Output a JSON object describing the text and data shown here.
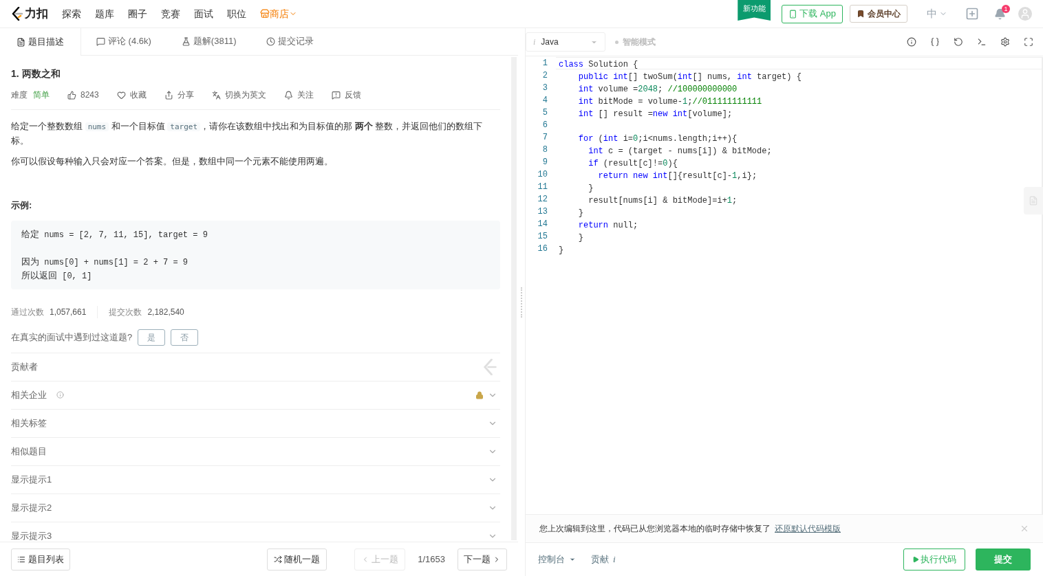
{
  "nav": {
    "brand": "力扣",
    "items": [
      {
        "label": "探索",
        "kind": "plain"
      },
      {
        "label": "题库",
        "kind": "plain"
      },
      {
        "label": "圈子",
        "kind": "plain"
      },
      {
        "label": "竞赛",
        "kind": "plain"
      },
      {
        "label": "面试",
        "kind": "plain"
      },
      {
        "label": "职位",
        "kind": "plain"
      },
      {
        "label": "商店",
        "kind": "store"
      }
    ],
    "new_feature": "新功能",
    "download": "下载 App",
    "vip": "会员中心",
    "language": "中",
    "notification_count": "1"
  },
  "tabs": [
    {
      "label": "题目描述",
      "selected": true
    },
    {
      "label": "评论 (4.6k)",
      "selected": false
    },
    {
      "label": "题解(3811)",
      "selected": false
    },
    {
      "label": "提交记录",
      "selected": false
    }
  ],
  "problem": {
    "title": "1. 两数之和",
    "difficulty_label": "难度",
    "difficulty": "简单",
    "actions": [
      "8243",
      "收藏",
      "分享",
      "切换为英文",
      "关注",
      "反馈"
    ],
    "paragraphs": [
      [
        {
          "kind": "text",
          "text": "给定一个整数数组 "
        },
        {
          "kind": "code",
          "text": "nums"
        },
        {
          "kind": "text",
          "text": " 和一个目标值 "
        },
        {
          "kind": "code",
          "text": "target"
        },
        {
          "kind": "text",
          "text": "，请你在该数组中找出和为目标值的那 **两个** 整数，并返回他们的数组下标。"
        }
      ],
      [
        {
          "kind": "text",
          "text": "你可以假设每种输入只会对应一个答案。但是，数组中同一个元素不能使用两遍。"
        }
      ]
    ],
    "example_heading": "示例:",
    "example_groups": [
      [
        [
          {
            "kind": "cjk",
            "text": "给定"
          },
          {
            "kind": "code",
            "text": " nums = [2, 7, 11, 15], target = 9"
          }
        ]
      ],
      [
        [
          {
            "kind": "cjk",
            "text": "因为"
          },
          {
            "kind": "code",
            "text": " nums[0] + nums[1] = 2 + 7 = 9"
          }
        ],
        [
          {
            "kind": "cjk",
            "text": "所以返回"
          },
          {
            "kind": "code",
            "text": " [0, 1]"
          }
        ]
      ]
    ],
    "stats": [
      {
        "label": "通过次数",
        "value": "1,057,661"
      },
      {
        "label": "提交次数",
        "value": "2,182,540"
      }
    ],
    "interview_question": "在真实的面试中遇到过这道题?",
    "interview_answers": [
      "是",
      "否"
    ],
    "sections": [
      {
        "label": "贡献者",
        "kind": "contributors",
        "expanded": false
      },
      {
        "label": "相关企业",
        "kind": "locked",
        "expanded": false
      },
      {
        "label": "相关标签",
        "kind": "plain",
        "expanded": false
      },
      {
        "label": "相似题目",
        "kind": "plain",
        "expanded": false
      },
      {
        "label": "显示提示1",
        "kind": "plain",
        "expanded": false
      },
      {
        "label": "显示提示2",
        "kind": "plain",
        "expanded": false
      },
      {
        "label": "显示提示3",
        "kind": "plain",
        "expanded": false
      }
    ]
  },
  "footer_left": {
    "list": "题目列表",
    "random": "随机一题",
    "prev": {
      "label": "上一题",
      "disabled": true
    },
    "page": "1/1653",
    "next": {
      "label": "下一题",
      "disabled": false
    }
  },
  "editor": {
    "language_hint": "i",
    "language": "Java",
    "smart_mode": {
      "label": "智能模式",
      "on": false
    },
    "lines": [
      {
        "number": "1",
        "tokens": [
          {
            "kind": "keyword",
            "text": "class"
          },
          {
            "kind": "plain",
            "text": " Solution {"
          }
        ]
      },
      {
        "number": "2",
        "tokens": [
          {
            "kind": "keyword",
            "text": "    public"
          },
          {
            "kind": "keyword",
            "text": " int"
          },
          {
            "kind": "plain",
            "text": "[] twoSum("
          },
          {
            "kind": "keyword",
            "text": "int"
          },
          {
            "kind": "plain",
            "text": "[] nums, "
          },
          {
            "kind": "keyword",
            "text": "int"
          },
          {
            "kind": "plain",
            "text": " target) {"
          }
        ]
      },
      {
        "number": "3",
        "tokens": [
          {
            "kind": "keyword",
            "text": "    int"
          },
          {
            "kind": "plain",
            "text": " volume ="
          },
          {
            "kind": "number",
            "text": "2048"
          },
          {
            "kind": "plain",
            "text": "; "
          },
          {
            "kind": "comment",
            "text": "//100000000000"
          }
        ]
      },
      {
        "number": "4",
        "tokens": [
          {
            "kind": "keyword",
            "text": "    int"
          },
          {
            "kind": "plain",
            "text": " bitMode = volume-"
          },
          {
            "kind": "number",
            "text": "1"
          },
          {
            "kind": "plain",
            "text": ";"
          },
          {
            "kind": "comment",
            "text": "//011111111111"
          }
        ]
      },
      {
        "number": "5",
        "tokens": [
          {
            "kind": "keyword",
            "text": "    int"
          },
          {
            "kind": "plain",
            "text": " [] result ="
          },
          {
            "kind": "keyword",
            "text": "new"
          },
          {
            "kind": "keyword",
            "text": " int"
          },
          {
            "kind": "plain",
            "text": "[volume];"
          }
        ]
      },
      {
        "number": "6"
      },
      {
        "number": "7",
        "tokens": [
          {
            "kind": "keyword",
            "text": "    for"
          },
          {
            "kind": "plain",
            "text": " ("
          },
          {
            "kind": "keyword",
            "text": "int"
          },
          {
            "kind": "plain",
            "text": " i="
          },
          {
            "kind": "number",
            "text": "0"
          },
          {
            "kind": "plain",
            "text": ";i<nums.length;i++){"
          }
        ]
      },
      {
        "number": "8",
        "tokens": [
          {
            "kind": "keyword",
            "text": "      int"
          },
          {
            "kind": "plain",
            "text": " c = (target - nums[i]) & bitMode;"
          }
        ]
      },
      {
        "number": "9",
        "tokens": [
          {
            "kind": "keyword",
            "text": "      if"
          },
          {
            "kind": "plain",
            "text": " (result[c]!="
          },
          {
            "kind": "number",
            "text": "0"
          },
          {
            "kind": "plain",
            "text": "){"
          }
        ]
      },
      {
        "number": "10",
        "tokens": [
          {
            "kind": "keyword",
            "text": "        return"
          },
          {
            "kind": "keyword",
            "text": " new"
          },
          {
            "kind": "keyword",
            "text": " int"
          },
          {
            "kind": "plain",
            "text": "[]{result[c]-"
          },
          {
            "kind": "number",
            "text": "1"
          },
          {
            "kind": "plain",
            "text": ",i};"
          }
        ]
      },
      {
        "number": "11",
        "tokens": [
          {
            "kind": "plain",
            "text": "      }"
          }
        ]
      },
      {
        "number": "12",
        "tokens": [
          {
            "kind": "plain",
            "text": "      result[nums[i] & bitMode]=i+"
          },
          {
            "kind": "number",
            "text": "1"
          },
          {
            "kind": "plain",
            "text": ";"
          }
        ]
      },
      {
        "number": "13",
        "tokens": [
          {
            "kind": "plain",
            "text": "    }"
          }
        ]
      },
      {
        "number": "14",
        "tokens": [
          {
            "kind": "keyword",
            "text": "    return"
          },
          {
            "kind": "plain",
            "text": " null;"
          }
        ]
      },
      {
        "number": "15",
        "tokens": [
          {
            "kind": "plain",
            "text": "    }"
          }
        ]
      },
      {
        "number": "16",
        "tokens": [
          {
            "kind": "plain",
            "text": "}"
          }
        ]
      }
    ],
    "notice": {
      "text": "您上次编辑到这里，代码已从您浏览器本地的临时存储中恢复了",
      "link": "还原默认代码模版"
    }
  },
  "footer_right": {
    "console": "控制台",
    "contribute": "贡献",
    "contribute_info": "i",
    "run": "执行代码",
    "submit": "提交"
  }
}
